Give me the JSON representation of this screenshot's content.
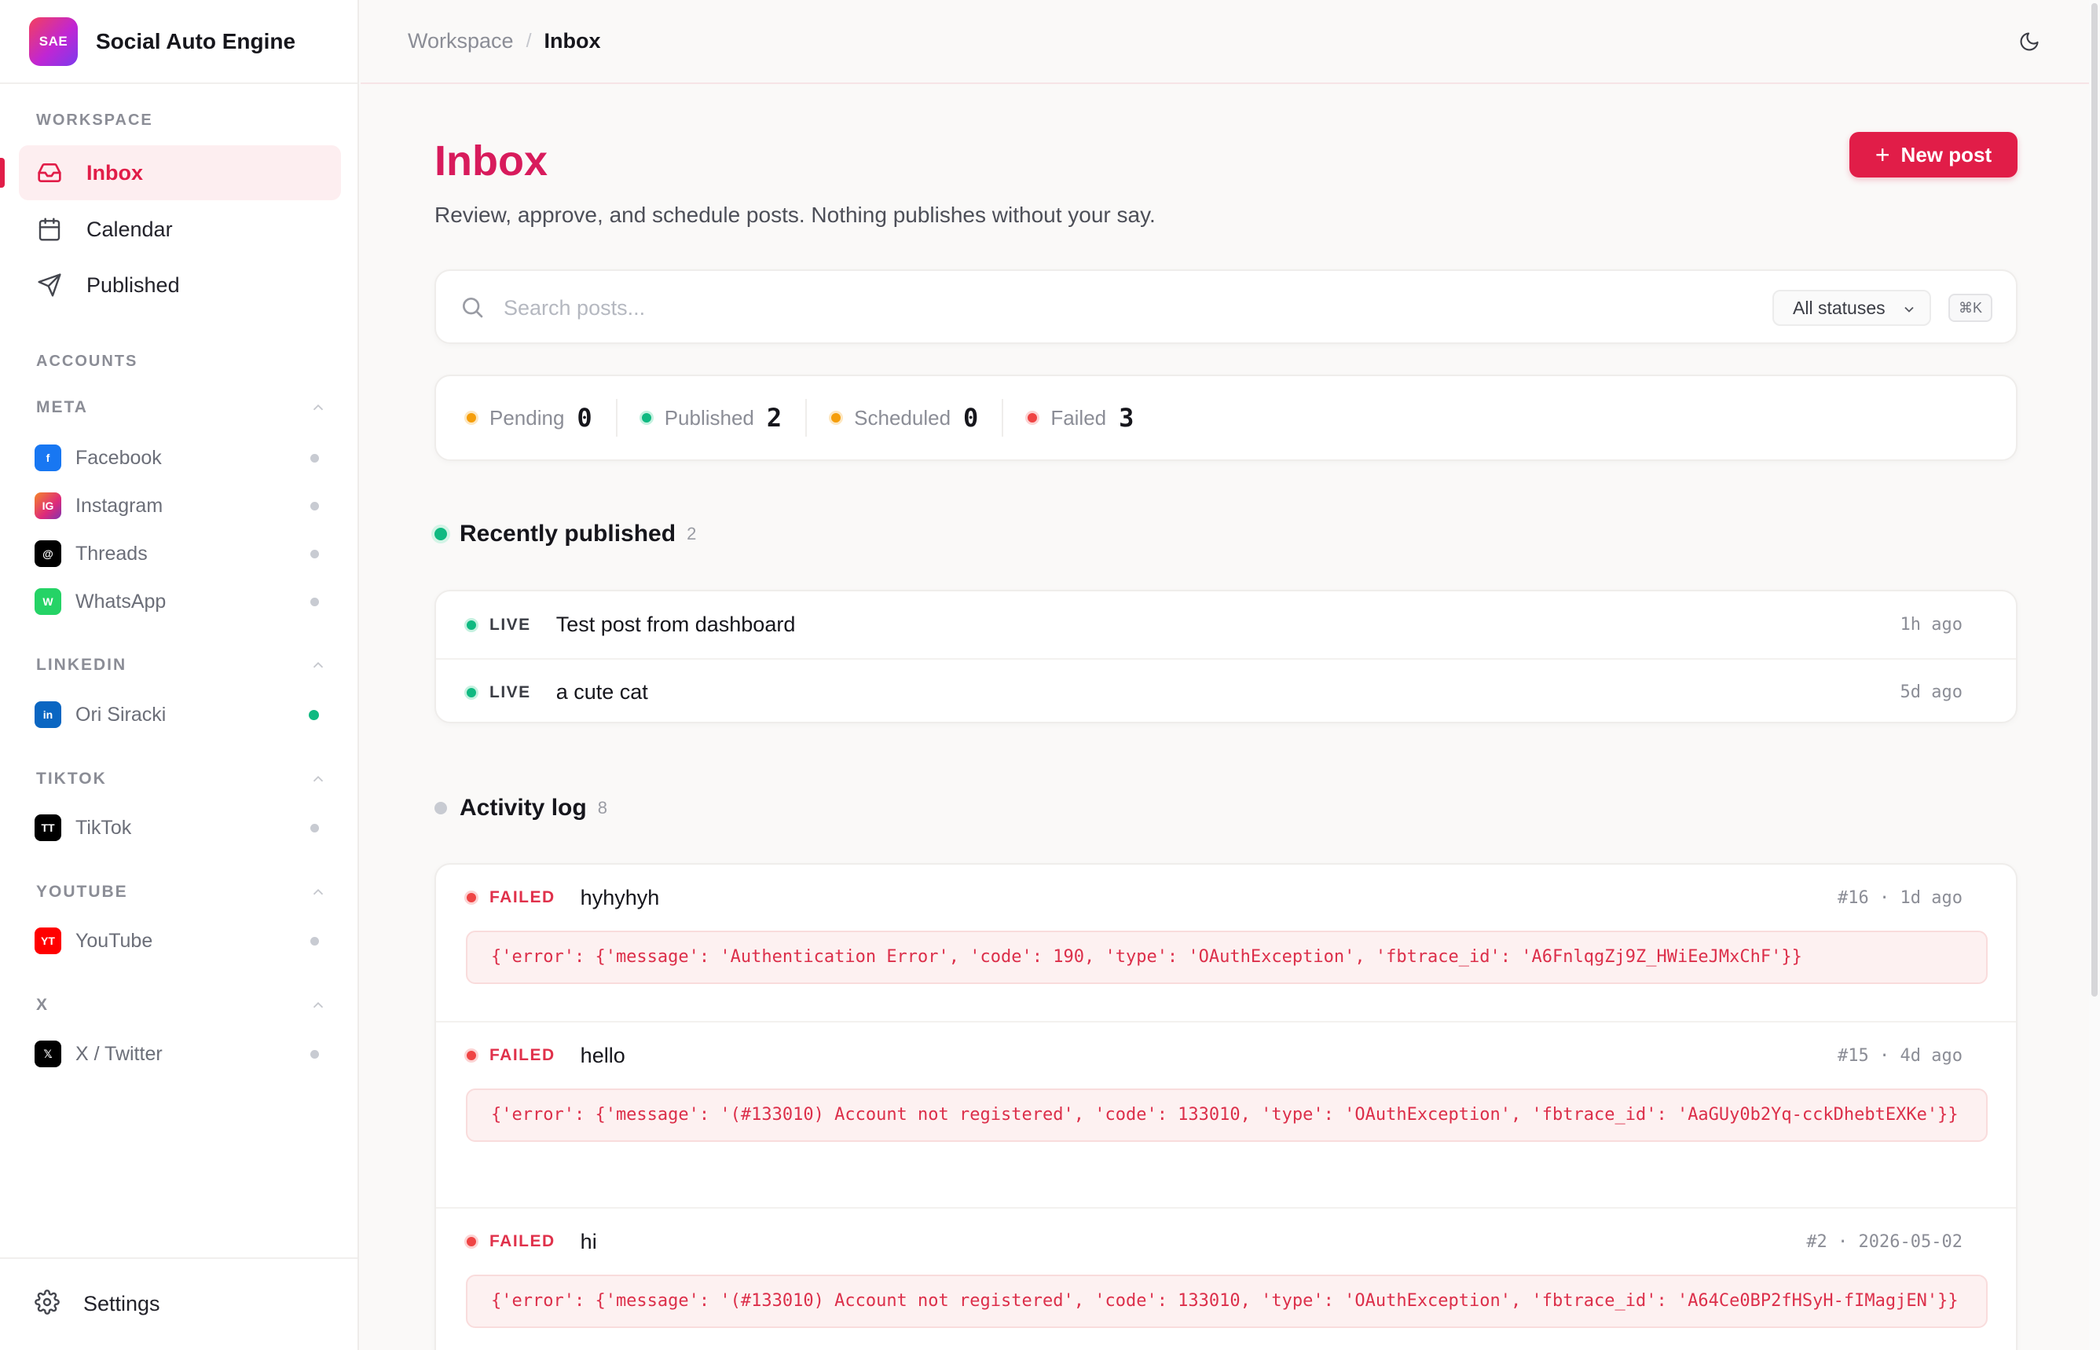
{
  "brand": {
    "logo_text": "SAE",
    "name": "Social Auto Engine"
  },
  "sidebar": {
    "workspace_title": "WORKSPACE",
    "nav": [
      {
        "label": "Inbox",
        "icon": "inbox-icon",
        "active": true
      },
      {
        "label": "Calendar",
        "icon": "calendar-icon",
        "active": false
      },
      {
        "label": "Published",
        "icon": "send-icon",
        "active": false
      }
    ],
    "accounts_title": "ACCOUNTS",
    "groups": [
      {
        "name": "META",
        "accounts": [
          {
            "badge": "f",
            "name": "Facebook",
            "color": "#1877f2",
            "connected": false
          },
          {
            "badge": "IG",
            "name": "Instagram",
            "color": "#e1306c",
            "connected": false
          },
          {
            "badge": "@",
            "name": "Threads",
            "color": "#000000",
            "connected": false
          },
          {
            "badge": "W",
            "name": "WhatsApp",
            "color": "#25d366",
            "connected": false
          }
        ]
      },
      {
        "name": "LINKEDIN",
        "accounts": [
          {
            "badge": "in",
            "name": "Ori Siracki",
            "color": "#0a66c2",
            "connected": true
          }
        ]
      },
      {
        "name": "TIKTOK",
        "accounts": [
          {
            "badge": "TT",
            "name": "TikTok",
            "color": "#000000",
            "connected": false
          }
        ]
      },
      {
        "name": "YOUTUBE",
        "accounts": [
          {
            "badge": "YT",
            "name": "YouTube",
            "color": "#ff0000",
            "connected": false
          }
        ]
      },
      {
        "name": "X",
        "accounts": [
          {
            "badge": "𝕏",
            "name": "X / Twitter",
            "color": "#000000",
            "connected": false
          }
        ]
      }
    ],
    "settings_label": "Settings"
  },
  "topbar": {
    "crumb_root": "Workspace",
    "crumb_sep": "/",
    "crumb_current": "Inbox"
  },
  "page": {
    "title": "Inbox",
    "subtitle": "Review, approve, and schedule posts. Nothing publishes without your say.",
    "new_post_label": "New post"
  },
  "search": {
    "placeholder": "Search posts...",
    "value": "",
    "status_filter": "All statuses",
    "shortcut": "⌘K"
  },
  "stats": [
    {
      "label": "Pending",
      "count": "0",
      "color": "#f59e0b"
    },
    {
      "label": "Published",
      "count": "2",
      "color": "#10b981"
    },
    {
      "label": "Scheduled",
      "count": "0",
      "color": "#f59e0b"
    },
    {
      "label": "Failed",
      "count": "3",
      "color": "#ef4444"
    }
  ],
  "recently_published": {
    "title": "Recently published",
    "count": "2",
    "items": [
      {
        "status": "LIVE",
        "title": "Test post from dashboard",
        "time": "1h ago"
      },
      {
        "status": "LIVE",
        "title": "a cute cat",
        "time": "5d ago"
      }
    ]
  },
  "activity_log": {
    "title": "Activity log",
    "count": "8",
    "items": [
      {
        "status": "FAILED",
        "title": "hyhyhyh",
        "meta": "#16 · 1d ago",
        "error": "{'error': {'message': 'Authentication Error', 'code': 190, 'type': 'OAuthException', 'fbtrace_id': 'A6FnlqgZj9Z_HWiEeJMxChF'}}"
      },
      {
        "status": "FAILED",
        "title": "hello",
        "meta": "#15 · 4d ago",
        "error": "{'error': {'message': '(#133010) Account not registered', 'code': 133010, 'type': 'OAuthException', 'fbtrace_id': 'AaGUy0b2Yq-cckDhebtEXKe'}}"
      },
      {
        "status": "FAILED",
        "title": "hi",
        "meta": "#2 · 2026-05-02",
        "error": "{'error': {'message': '(#133010) Account not registered', 'code': 133010, 'type': 'OAuthException', 'fbtrace_id': 'A64Ce0BP2fHSyH-fIMagjEN'}}"
      }
    ]
  }
}
